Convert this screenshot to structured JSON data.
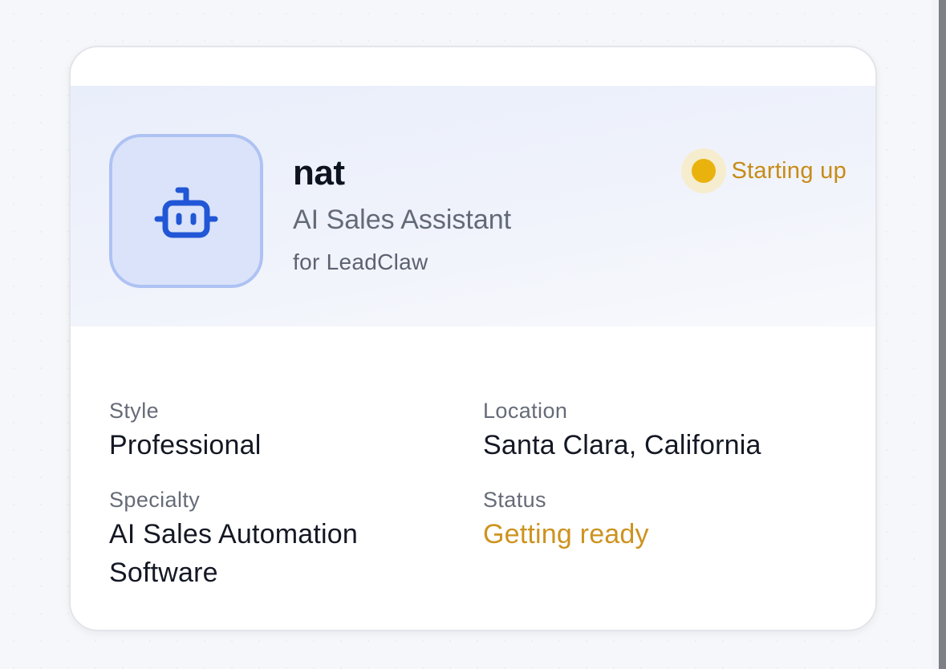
{
  "agent": {
    "name": "nat",
    "role": "AI Sales Assistant",
    "company": "for LeadClaw",
    "avatar_icon": "robot-icon",
    "status_label": "Starting up",
    "status_color": "#eab20d"
  },
  "details": {
    "style": {
      "label": "Style",
      "value": "Professional"
    },
    "location": {
      "label": "Location",
      "value": "Santa Clara, California"
    },
    "specialty": {
      "label": "Specialty",
      "value": "AI Sales Automation Software"
    },
    "status": {
      "label": "Status",
      "value": "Getting ready"
    }
  },
  "colors": {
    "accent": "#2157d6",
    "status_text": "#c78b16"
  }
}
